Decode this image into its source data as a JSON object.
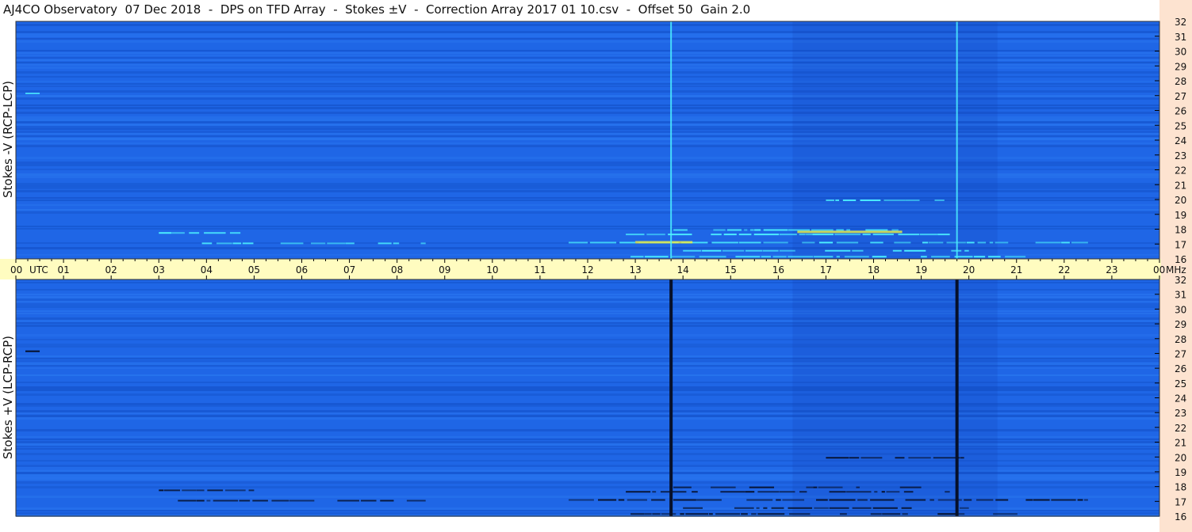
{
  "title": "AJ4CO Observatory  07 Dec 2018  -  DPS on TFD Array  -  Stokes ±V  -  Correction Array 2017 01 10.csv  -  Offset 50  Gain 2.0",
  "colors": {
    "background": "#1f66e6",
    "band_dark": "#1452c9",
    "band_light": "#2b78f0",
    "time_axis_bg": "#fffcc0",
    "freq_axis_bg": "#fde3d0",
    "burst_bright": "#4cf0ff",
    "burst_yellow": "#f0f040",
    "burst_dark": "#06102a"
  },
  "chart_data": [
    {
      "type": "heatmap",
      "panel": "top",
      "ylabel": "Stokes -V  (RCP-LCP)",
      "xlabel": "UTC",
      "yunit": "MHz",
      "x_range_utc_hours": [
        0,
        24
      ],
      "ylim_mhz": [
        16,
        32
      ],
      "xticks": [
        "00",
        "01",
        "02",
        "03",
        "04",
        "05",
        "06",
        "07",
        "08",
        "09",
        "10",
        "11",
        "12",
        "13",
        "14",
        "15",
        "16",
        "17",
        "18",
        "19",
        "20",
        "21",
        "22",
        "23",
        "00"
      ],
      "yticks": [
        "32",
        "31",
        "30",
        "29",
        "28",
        "27",
        "26",
        "25",
        "24",
        "23",
        "22",
        "21",
        "20",
        "19",
        "18",
        "17",
        "16"
      ],
      "vertical_lines_utc": [
        13.75,
        19.75
      ],
      "vertical_line_style": "bright",
      "burst_style": "bright"
    },
    {
      "type": "heatmap",
      "panel": "bottom",
      "ylabel": "Stokes +V  (LCP-RCP)",
      "xlabel": "UTC",
      "yunit": "MHz",
      "x_range_utc_hours": [
        0,
        24
      ],
      "ylim_mhz": [
        16,
        32
      ],
      "yticks": [
        "32",
        "31",
        "30",
        "29",
        "28",
        "27",
        "26",
        "25",
        "24",
        "23",
        "22",
        "21",
        "20",
        "19",
        "18",
        "17",
        "16"
      ],
      "vertical_lines_utc": [
        13.75,
        19.75
      ],
      "vertical_line_style": "dark",
      "burst_style": "dark"
    }
  ]
}
